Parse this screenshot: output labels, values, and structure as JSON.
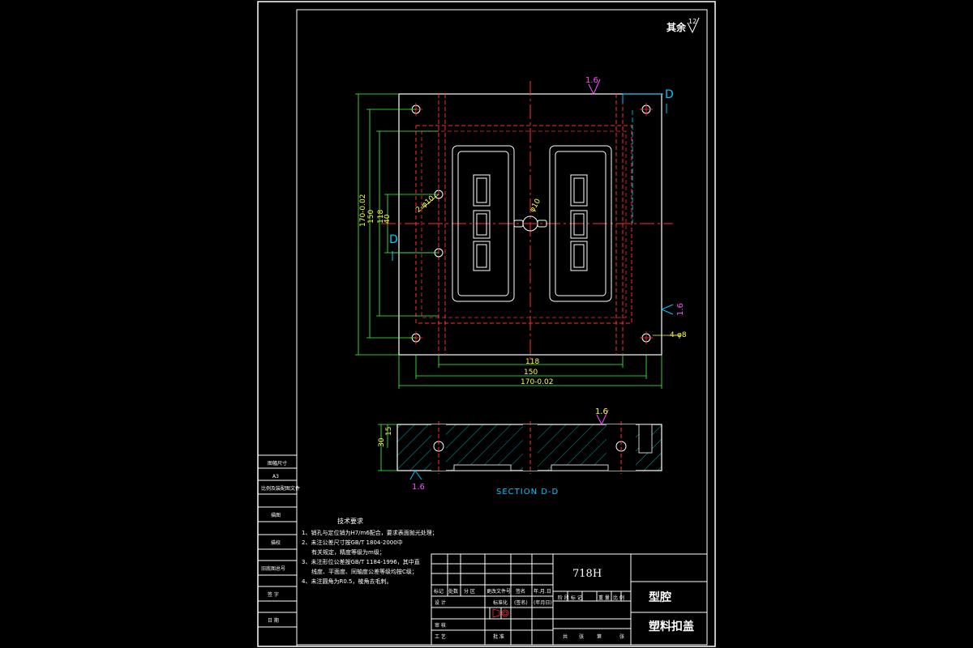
{
  "roughness": {
    "prefix": "其余",
    "value": "12"
  },
  "plan_view": {
    "section_marker": "D",
    "surface_top": "1.6",
    "surface_right": "1.6",
    "dims_bottom": [
      "118",
      "150",
      "170-0.02"
    ],
    "dims_left": [
      "170-0.02",
      "150",
      "118",
      "40"
    ],
    "hole_left": "2-φ10",
    "hole_center": "φ10",
    "hole_right": "4-φ8"
  },
  "section_view": {
    "title": "SECTION D-D",
    "dim_height": "30",
    "dim_depth": "15",
    "surface_top": "1.6",
    "surface_bottom": "1.6"
  },
  "left_strip": {
    "cells": [
      "图幅尺寸",
      "A3",
      "比例及装配图文件",
      "描图",
      "描校",
      "旧底图总号",
      "签 字",
      "日 期"
    ]
  },
  "tech_requirements": {
    "title": "技术要求",
    "items": [
      "1、销孔与定位销为H7/m6配合，要求表面抛光处理；",
      "2、未注公差尺寸按GB/T 1804-2000中",
      "有关规定，精度等级为m级；",
      "3、未注形位公差按GB/T 1184-1996，其中直",
      "线度、平面度、同轴度公差等级均按C级；",
      "4、未注圆角为R0.5，棱角去毛刺。"
    ]
  },
  "title_block": {
    "material": "718H",
    "part_name": "型腔",
    "product_name": "塑料扣盖",
    "row_labels": [
      "标记",
      "处数",
      "分 区",
      "更改文件号",
      "签名",
      "年.月.日"
    ],
    "design": "设 计",
    "standard": "标准化",
    "sign_short": "(签名)",
    "date_short": "(年月日)",
    "check": "审 核",
    "process": "工 艺",
    "approve": "批 准",
    "stage_labels": [
      "阶 段 标 记",
      "重 量",
      "比 例"
    ],
    "sheet_labels": [
      "共",
      "张",
      "第",
      "张"
    ]
  }
}
